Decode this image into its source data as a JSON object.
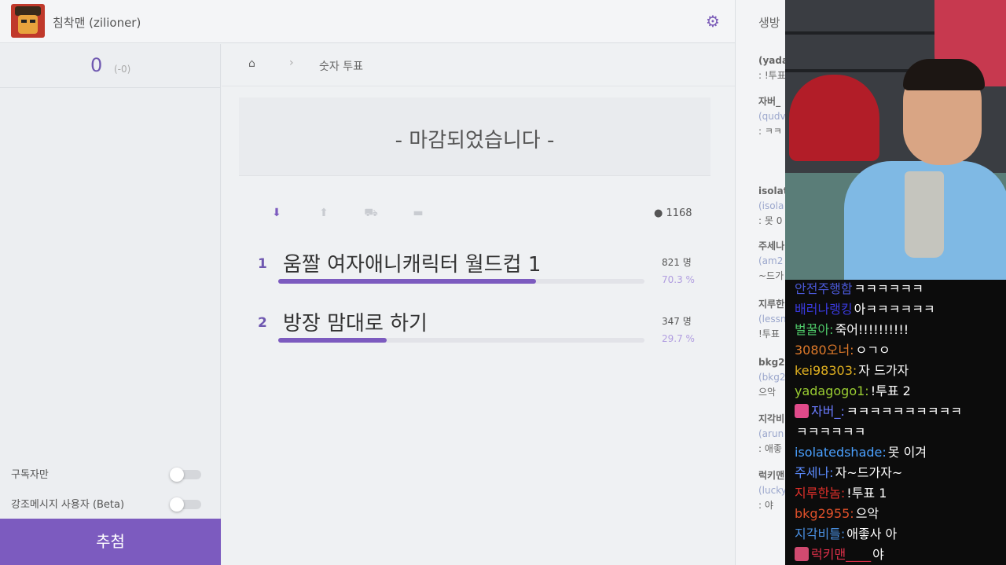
{
  "header": {
    "username": "침착맨 (zilioner)",
    "settings_icon": "gear-icon"
  },
  "left": {
    "count": "0",
    "count_delta": "(-0)",
    "toggles": [
      {
        "label": "구독자만",
        "on": false
      },
      {
        "label": "강조메시지 사용자 (Beta)",
        "on": false
      }
    ],
    "draw_button": "추첨"
  },
  "main": {
    "breadcrumb": {
      "home_icon": "home-icon",
      "current": "숫자 투표"
    },
    "closed_text": "- 마감되었습니다 -",
    "total_votes": "1168",
    "options": [
      {
        "num": "1",
        "label": "움짤 여자애니캐릭터 월드컵 1",
        "votes": "821 명",
        "percent": "70.3 %",
        "ratio": 0.703
      },
      {
        "num": "2",
        "label": "방장 맘대로 하기",
        "votes": "347 명",
        "percent": "29.7 %",
        "ratio": 0.297
      }
    ]
  },
  "chat_panel": {
    "title": "생방",
    "entries": [
      {
        "name": "(yada",
        "msg": ": !투표"
      },
      {
        "name": "자버_",
        "id": "(qudv",
        "msg": ": ㅋㅋ"
      },
      {
        "name": "isolat",
        "id": "(isola",
        "msg": ": 못 0"
      },
      {
        "name": "주세나",
        "id": "(am2",
        "msg": "~드가"
      },
      {
        "name": "지루한",
        "id": "(lessn",
        "msg": "!투표"
      },
      {
        "name": "bkg2",
        "id": "(bkg2",
        "msg": "으악"
      },
      {
        "name": "지각비",
        "id": "(arun",
        "msg": ": 애좋"
      },
      {
        "name": "럭키맨",
        "id": "(lucky",
        "msg": ": 야"
      }
    ]
  },
  "overlay": {
    "lines": [
      {
        "nick": "안전주행함",
        "nick_color": "#4a58d6",
        "msg": "ㅋㅋㅋㅋㅋㅋ"
      },
      {
        "nick": "배러나랭킹",
        "nick_color": "#3a3ae0",
        "msg": "아ㅋㅋㅋㅋㅋㅋ"
      },
      {
        "nick": "벌꿀아:",
        "nick_color": "#4fcb6a",
        "msg": "죽어!!!!!!!!!!"
      },
      {
        "nick": "3080오너:",
        "nick_color": "#e07a2a",
        "msg": "ㅇㄱㅇ"
      },
      {
        "nick": "kei98303:",
        "nick_color": "#e0b020",
        "msg": "자 드가자"
      },
      {
        "nick": "yadagogo1:",
        "nick_color": "#9acd32",
        "msg": "!투표 2"
      },
      {
        "nick": "자버_:",
        "nick_color": "#6a7bff",
        "msg": "ㅋㅋㅋㅋㅋㅋㅋㅋㅋㅋ",
        "badge": "skull-badge-icon"
      },
      {
        "nick": "",
        "nick_color": "#ffffff",
        "msg": "ㅋㅋㅋㅋㅋㅋ"
      },
      {
        "nick": "isolatedshade:",
        "nick_color": "#4aa0ff",
        "msg": "못 이겨"
      },
      {
        "nick": "주세나:",
        "nick_color": "#5b8cff",
        "msg": "자~드가자~"
      },
      {
        "nick": "지루한놈:",
        "nick_color": "#e0302a",
        "msg": "!투표 1"
      },
      {
        "nick": "bkg2955:",
        "nick_color": "#e0502a",
        "msg": "으악"
      },
      {
        "nick": "지각비틀:",
        "nick_color": "#4a90e2",
        "msg": "애좋사 아"
      },
      {
        "nick": "럭키맨____",
        "nick_color": "#e0304a",
        "msg": "야",
        "badge": "flower-badge-icon"
      }
    ]
  },
  "colors": {
    "accent": "#7c5bbf",
    "bar_track": "#e2e3e8"
  }
}
